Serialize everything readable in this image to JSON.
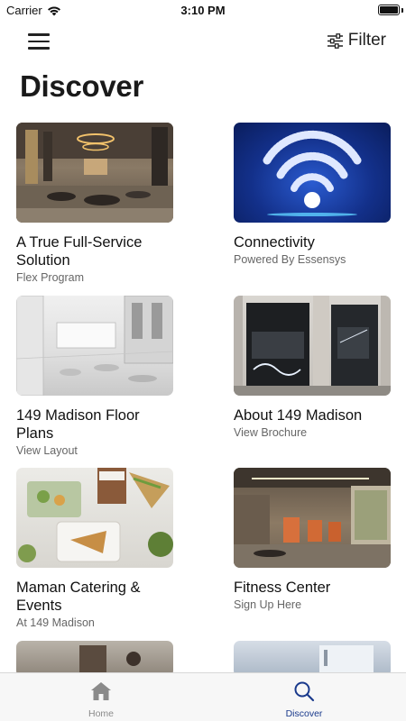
{
  "status": {
    "carrier": "Carrier",
    "time": "3:10 PM"
  },
  "nav": {
    "filter_label": "Filter"
  },
  "page_title": "Discover",
  "cards": [
    {
      "title": "A True Full-Service Solution",
      "subtitle": "Flex Program",
      "image": "lounge-interior"
    },
    {
      "title": "Connectivity",
      "subtitle": "Powered By Essensys",
      "image": "wifi-graphic"
    },
    {
      "title": "149 Madison Floor Plans",
      "subtitle": "View Layout",
      "image": "floor-render"
    },
    {
      "title": "About 149 Madison",
      "subtitle": "View Brochure",
      "image": "building-facade"
    },
    {
      "title": "Maman Catering & Events",
      "subtitle": "At 149 Madison",
      "image": "catering-food"
    },
    {
      "title": "Fitness Center",
      "subtitle": "Sign Up Here",
      "image": "gym-interior"
    }
  ],
  "tabs": [
    {
      "label": "Home",
      "icon": "home-icon",
      "active": false
    },
    {
      "label": "Discover",
      "icon": "search-icon",
      "active": true
    }
  ],
  "colors": {
    "accent": "#1a3a8c",
    "inactive": "#8a8a8a"
  }
}
